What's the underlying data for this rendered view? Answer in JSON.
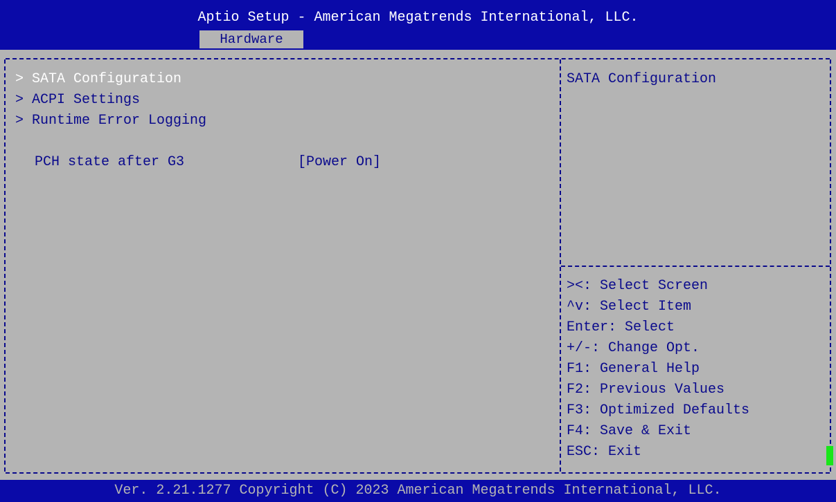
{
  "header": {
    "title": "Aptio Setup - American Megatrends International, LLC.",
    "active_tab": "Hardware"
  },
  "menu": {
    "items": [
      {
        "label": "> SATA Configuration",
        "selected": true
      },
      {
        "label": "> ACPI Settings",
        "selected": false
      },
      {
        "label": "> Runtime Error Logging",
        "selected": false
      }
    ],
    "settings": [
      {
        "label": "PCH state after G3",
        "value": "[Power On]"
      }
    ]
  },
  "help": {
    "text": "SATA Configuration"
  },
  "keys": [
    "><: Select Screen",
    "^v: Select Item",
    "Enter: Select",
    "+/-: Change Opt.",
    "F1: General Help",
    "F2: Previous Values",
    "F3: Optimized Defaults",
    "F4: Save & Exit",
    "ESC: Exit"
  ],
  "footer": {
    "text": "Ver. 2.21.1277 Copyright (C) 2023 American Megatrends International, LLC."
  },
  "colors": {
    "header_bg": "#0a0aa8",
    "body_bg": "#b4b4b4",
    "text": "#0a0a8c",
    "highlight": "#ffffff",
    "cursor": "#19e619"
  }
}
